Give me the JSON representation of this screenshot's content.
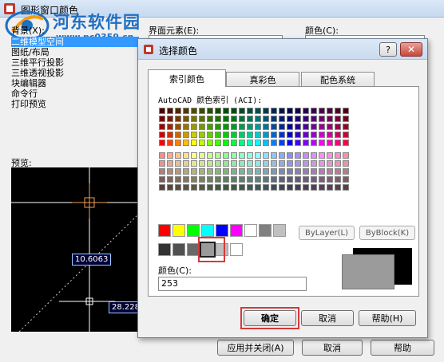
{
  "background_window": {
    "title": "图形窗口颜色",
    "context_label": "背景(X):",
    "context_items": [
      "二维模型空间",
      "图纸/布局",
      "三维平行投影",
      "三维透视投影",
      "块编辑器",
      "命令行",
      "打印预览"
    ],
    "element_label": "界面元素(E):",
    "color_label": "颜色(C):",
    "preview_label": "预览:",
    "preview_dim_1": "10.6063",
    "preview_dim_2": "28.228",
    "apply_close_button": "应用并关闭(A)",
    "cancel_button": "取消",
    "help_button": "帮助"
  },
  "watermark": {
    "name": "河东软件园",
    "url": "www.pc0359.cn"
  },
  "dialog": {
    "title": "选择颜色",
    "help_button": "?",
    "close_button": "✕",
    "tabs": [
      {
        "label": "索引颜色",
        "active": true
      },
      {
        "label": "真彩色",
        "active": false
      },
      {
        "label": "配色系统",
        "active": false
      }
    ],
    "aci_label": "AutoCAD 颜色索引 (ACI):",
    "bylayer_button": "ByLayer(L)",
    "byblock_button": "ByBlock(K)",
    "color_field_label": "颜色(C):",
    "color_value": "253",
    "selected_color": "#9b9b9b",
    "ok_button": "确定",
    "cancel_button": "取消",
    "help_button_label": "帮助(H)"
  },
  "standard_colors": [
    "#ff0000",
    "#ffff00",
    "#00ff00",
    "#00ffff",
    "#0000ff",
    "#ff00ff",
    "#ffffff",
    "#808080",
    "#c0c0c0"
  ],
  "gray_colors": [
    "#333333",
    "#505050",
    "#696969",
    "#828282",
    "#bebebe",
    "#ffffff"
  ],
  "colors": {
    "accent_highlight": "#d33a3a",
    "preview_background": "#000000"
  }
}
